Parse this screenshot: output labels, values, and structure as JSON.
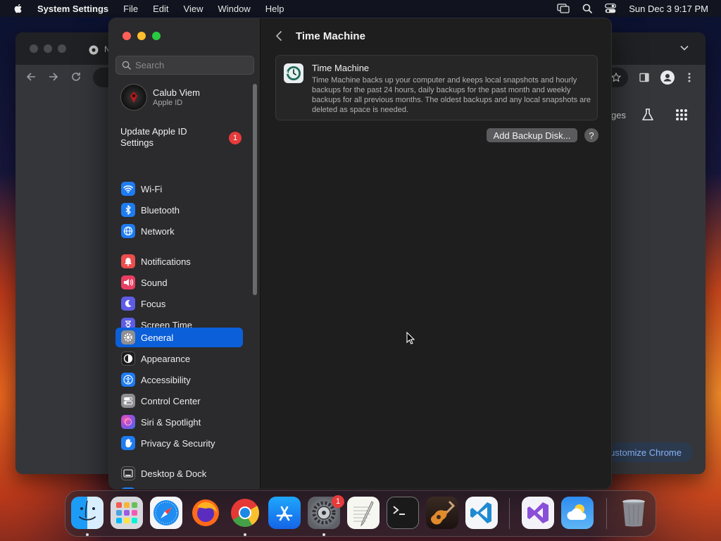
{
  "menubar": {
    "app_name": "System Settings",
    "items": [
      "File",
      "Edit",
      "View",
      "Window",
      "Help"
    ],
    "datetime": "Sun Dec 3  9:17 PM"
  },
  "chrome": {
    "tab_title": "N",
    "ntp_fragment": "ges",
    "customize_label": "ustomize Chrome"
  },
  "sidebar": {
    "search_placeholder": "Search",
    "account": {
      "name": "Calub Viem",
      "subtitle": "Apple ID"
    },
    "update": {
      "label": "Update Apple ID Settings",
      "badge": "1"
    },
    "items": [
      {
        "label": "Wi-Fi",
        "icon": "wifi-icon",
        "color": "#1e7cf2"
      },
      {
        "label": "Bluetooth",
        "icon": "bluetooth-icon",
        "color": "#1e7cf2"
      },
      {
        "label": "Network",
        "icon": "globe-icon",
        "color": "#1e7cf2"
      },
      {
        "label": "Notifications",
        "icon": "bell-icon",
        "color": "#ec4d4d"
      },
      {
        "label": "Sound",
        "icon": "speaker-icon",
        "color": "#e83e62"
      },
      {
        "label": "Focus",
        "icon": "moon-icon",
        "color": "#5e5ce6"
      },
      {
        "label": "Screen Time",
        "icon": "hourglass-icon",
        "color": "#5e5ce6"
      },
      {
        "label": "General",
        "icon": "gear-icon",
        "color": "#8e8e93",
        "selected": true
      },
      {
        "label": "Appearance",
        "icon": "appearance-icon",
        "color": "#1c1c1e"
      },
      {
        "label": "Accessibility",
        "icon": "accessibility-icon",
        "color": "#1e7cf2"
      },
      {
        "label": "Control Center",
        "icon": "toggles-icon",
        "color": "#8e8e93"
      },
      {
        "label": "Siri & Spotlight",
        "icon": "siri-icon",
        "color": "#a24ad9"
      },
      {
        "label": "Privacy & Security",
        "icon": "hand-icon",
        "color": "#1e7cf2"
      },
      {
        "label": "Desktop & Dock",
        "icon": "dock-icon",
        "color": "#2c2c2e"
      }
    ]
  },
  "main": {
    "title": "Time Machine",
    "card": {
      "title": "Time Machine",
      "description": "Time Machine backs up your computer and keeps local snapshots and hourly backups for the past 24 hours, daily backups for the past month and weekly backups for all previous months. The oldest backups and any local snapshots are deleted as space is needed."
    },
    "add_backup_label": "Add Backup Disk...",
    "help_label": "?"
  },
  "dock": {
    "apps": [
      {
        "name": "finder",
        "running": true
      },
      {
        "name": "launchpad",
        "running": false
      },
      {
        "name": "safari",
        "running": false
      },
      {
        "name": "firefox",
        "running": false
      },
      {
        "name": "chrome",
        "running": true
      },
      {
        "name": "app-store",
        "running": false
      },
      {
        "name": "system-settings",
        "running": true,
        "badge": "1"
      },
      {
        "name": "textedit",
        "running": false
      },
      {
        "name": "terminal",
        "running": false
      },
      {
        "name": "garageband",
        "running": false
      },
      {
        "name": "vscode",
        "running": false
      },
      {
        "name": "visual-studio",
        "running": false
      },
      {
        "name": "weather",
        "running": false
      },
      {
        "name": "trash",
        "running": false
      }
    ]
  },
  "colors": {
    "accent": "#0b5fd8",
    "badge": "#e63b3b"
  }
}
